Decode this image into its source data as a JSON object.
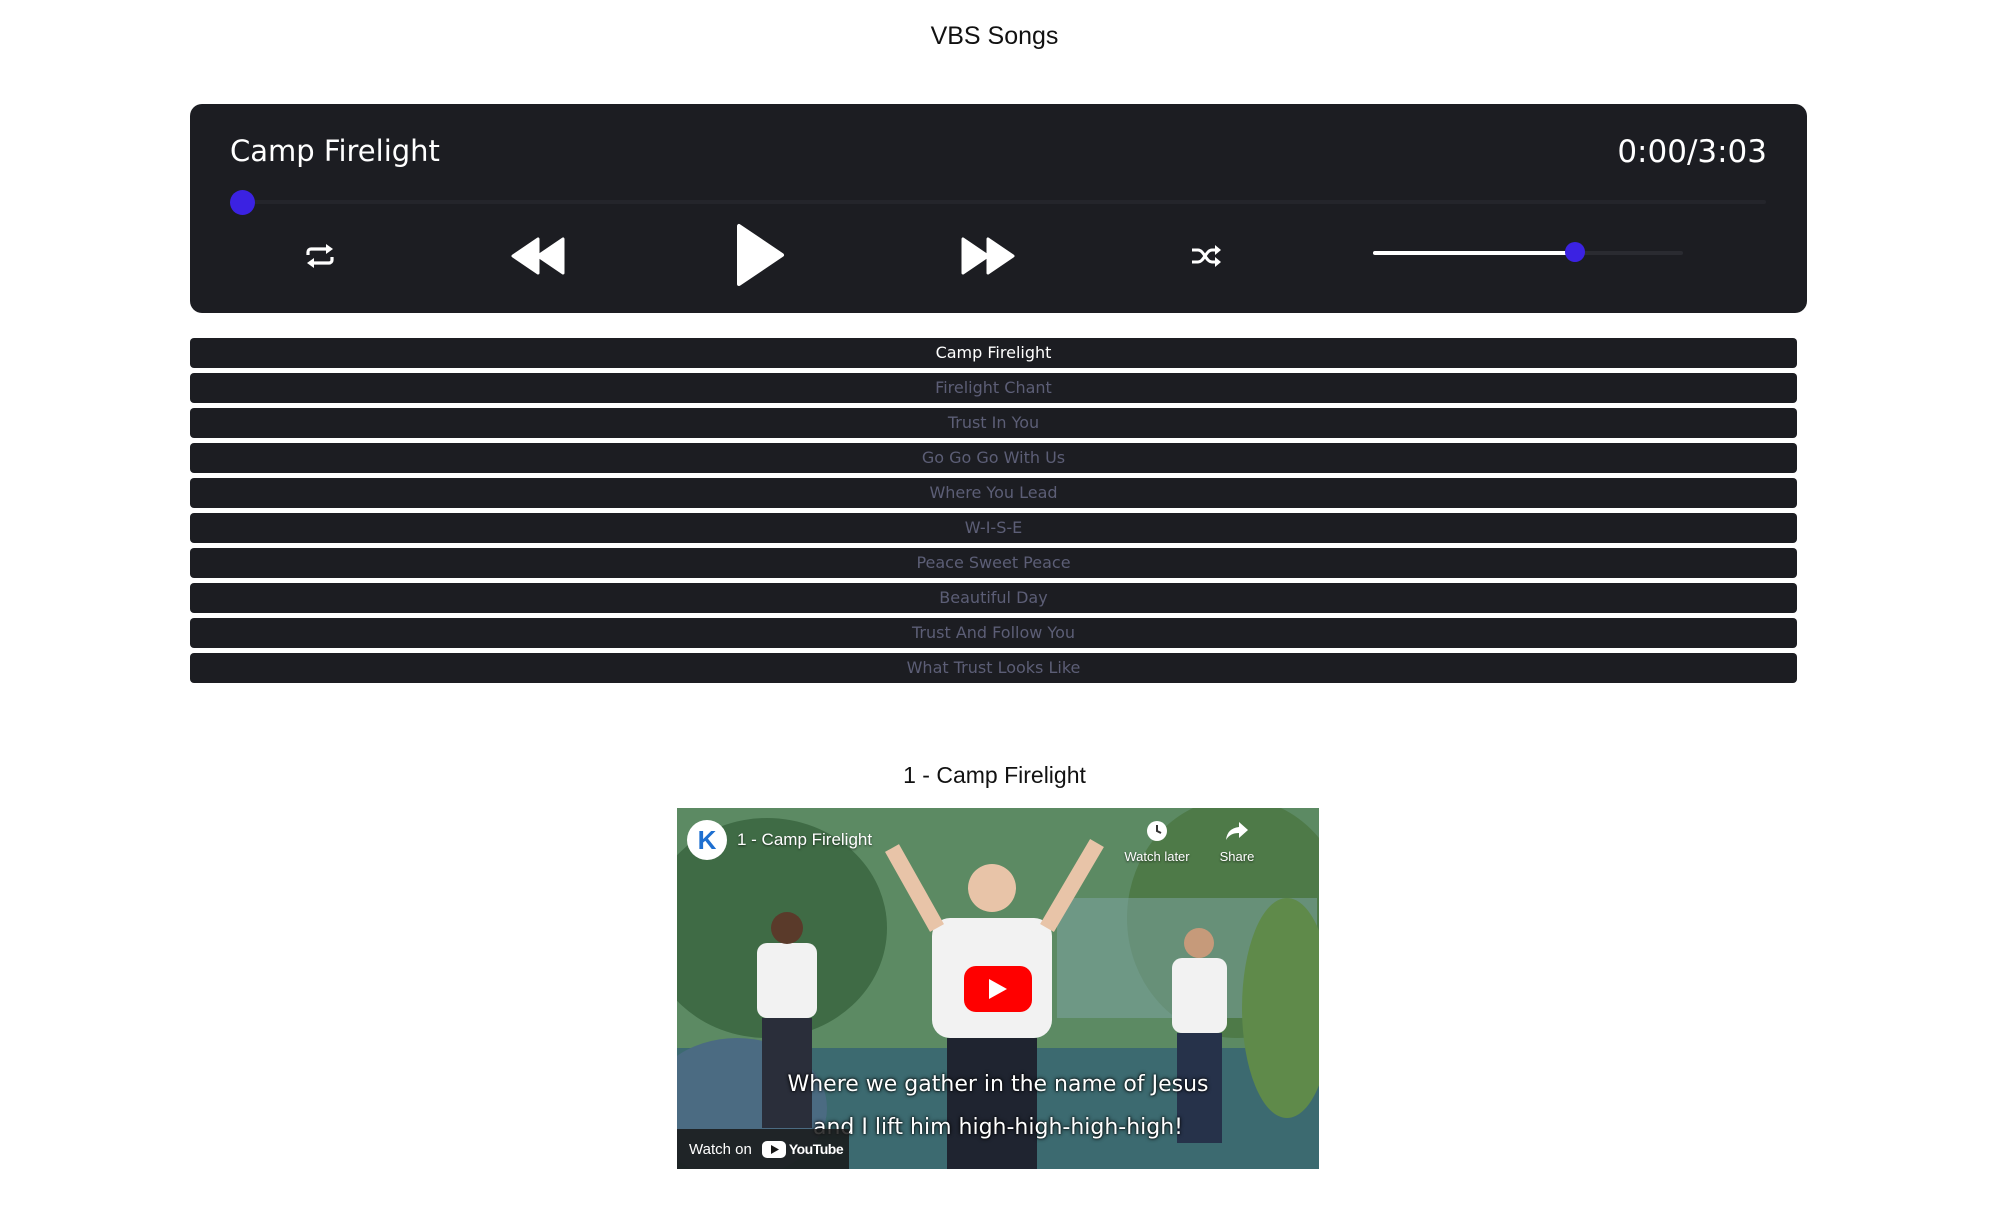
{
  "page": {
    "title": "VBS Songs"
  },
  "player": {
    "track_title": "Camp Firelight",
    "time": "0:00/3:03",
    "progress_fraction": 0.0,
    "volume_fraction": 0.65,
    "icons": {
      "repeat": "repeat-icon",
      "rewind": "rewind-icon",
      "play": "play-icon",
      "fast_forward": "fast-forward-icon",
      "shuffle": "shuffle-icon"
    },
    "accent_color": "#3b22e2",
    "background_color": "#1c1d22"
  },
  "playlist": {
    "active_index": 0,
    "items": [
      "Camp Firelight",
      "Firelight Chant",
      "Trust In You",
      "Go Go Go With Us",
      "Where You Lead",
      "W-I-S-E",
      "Peace Sweet Peace",
      "Beautiful Day",
      "Trust And Follow You",
      "What Trust Looks Like"
    ]
  },
  "video": {
    "heading": "1 - Camp Firelight",
    "embed_title": "1 - Camp Firelight",
    "channel_logo_letter": "K",
    "watch_later_label": "Watch later",
    "share_label": "Share",
    "caption_line1": "Where we gather in the name of Jesus",
    "caption_line2": "and I lift him high-high-high-high!",
    "watch_on_label": "Watch on",
    "youtube_label": "YouTube"
  }
}
